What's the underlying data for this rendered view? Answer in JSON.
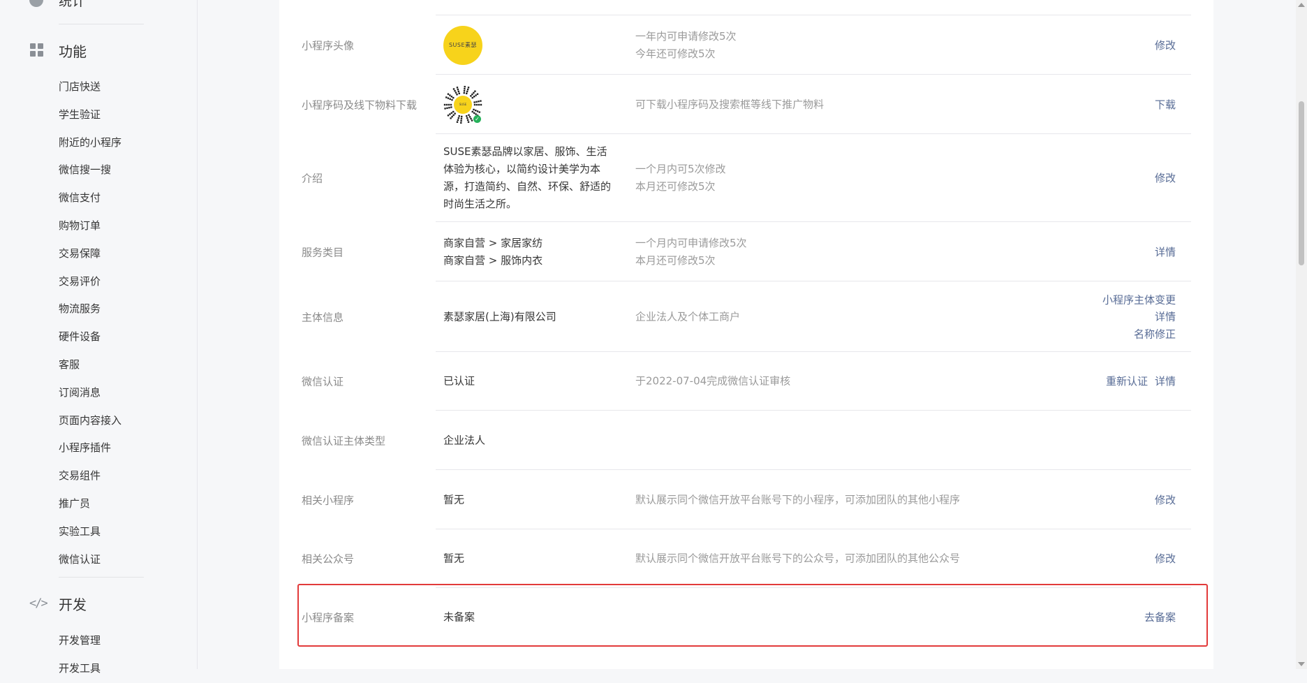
{
  "sidebar": {
    "top_item": "统计",
    "sections": [
      {
        "icon": "grid-icon",
        "title": "功能",
        "items": [
          "门店快送",
          "学生验证",
          "附近的小程序",
          "微信搜一搜",
          "微信支付",
          "购物订单",
          "交易保障",
          "交易评价",
          "物流服务",
          "硬件设备",
          "客服",
          "订阅消息",
          "页面内容接入",
          "小程序插件",
          "交易组件",
          "推广员",
          "实验工具",
          "微信认证"
        ]
      },
      {
        "icon": "code-icon",
        "title": "开发",
        "items": [
          "开发管理",
          "开发工具"
        ]
      }
    ]
  },
  "rows": [
    {
      "label": "小程序头像",
      "logo_text": "SUSE素瑟",
      "desc": [
        "一年内可申请修改5次",
        "今年还可修改5次"
      ],
      "actions": [
        "修改"
      ]
    },
    {
      "label": "小程序码及线下物料下载",
      "logo_text": "SUSE",
      "desc": [
        "可下载小程序码及搜索框等线下推广物料"
      ],
      "actions": [
        "下载"
      ]
    },
    {
      "label": "介绍",
      "value": [
        "SUSE素瑟品牌以家居、服饰、生活",
        "体验为核心，以简约设计美学为本",
        "源，打造简约、自然、环保、舒适的",
        "时尚生活之所。"
      ],
      "desc": [
        "一个月内可5次修改",
        "本月还可修改5次"
      ],
      "actions": [
        "修改"
      ]
    },
    {
      "label": "服务类目",
      "value": [
        "商家自营 > 家居家纺",
        "商家自营 > 服饰内衣"
      ],
      "desc": [
        "一个月内可申请修改5次",
        "本月还可修改5次"
      ],
      "actions": [
        "详情"
      ]
    },
    {
      "label": "主体信息",
      "value": [
        "素瑟家居(上海)有限公司"
      ],
      "desc": [
        "企业法人及个体工商户"
      ],
      "actions": [
        "小程序主体变更",
        "详情",
        "名称修正"
      ]
    },
    {
      "label": "微信认证",
      "value": [
        "已认证"
      ],
      "desc": [
        "于2022-07-04完成微信认证审核"
      ],
      "actions": [
        "重新认证",
        "详情"
      ]
    },
    {
      "label": "微信认证主体类型",
      "value": [
        "企业法人"
      ],
      "desc": [],
      "actions": []
    },
    {
      "label": "相关小程序",
      "value": [
        "暂无"
      ],
      "desc": [
        "默认展示同个微信开放平台账号下的小程序，可添加团队的其他小程序"
      ],
      "actions": [
        "修改"
      ]
    },
    {
      "label": "相关公众号",
      "value": [
        "暂无"
      ],
      "desc": [
        "默认展示同个微信开放平台账号下的公众号，可添加团队的其他公众号"
      ],
      "actions": [
        "修改"
      ]
    },
    {
      "label": "小程序备案",
      "value": [
        "未备案"
      ],
      "desc": [],
      "actions": [
        "去备案"
      ]
    }
  ],
  "colors": {
    "link": "#576b95",
    "highlight": "#e23a3a",
    "logo_yellow": "#f7d31b"
  }
}
